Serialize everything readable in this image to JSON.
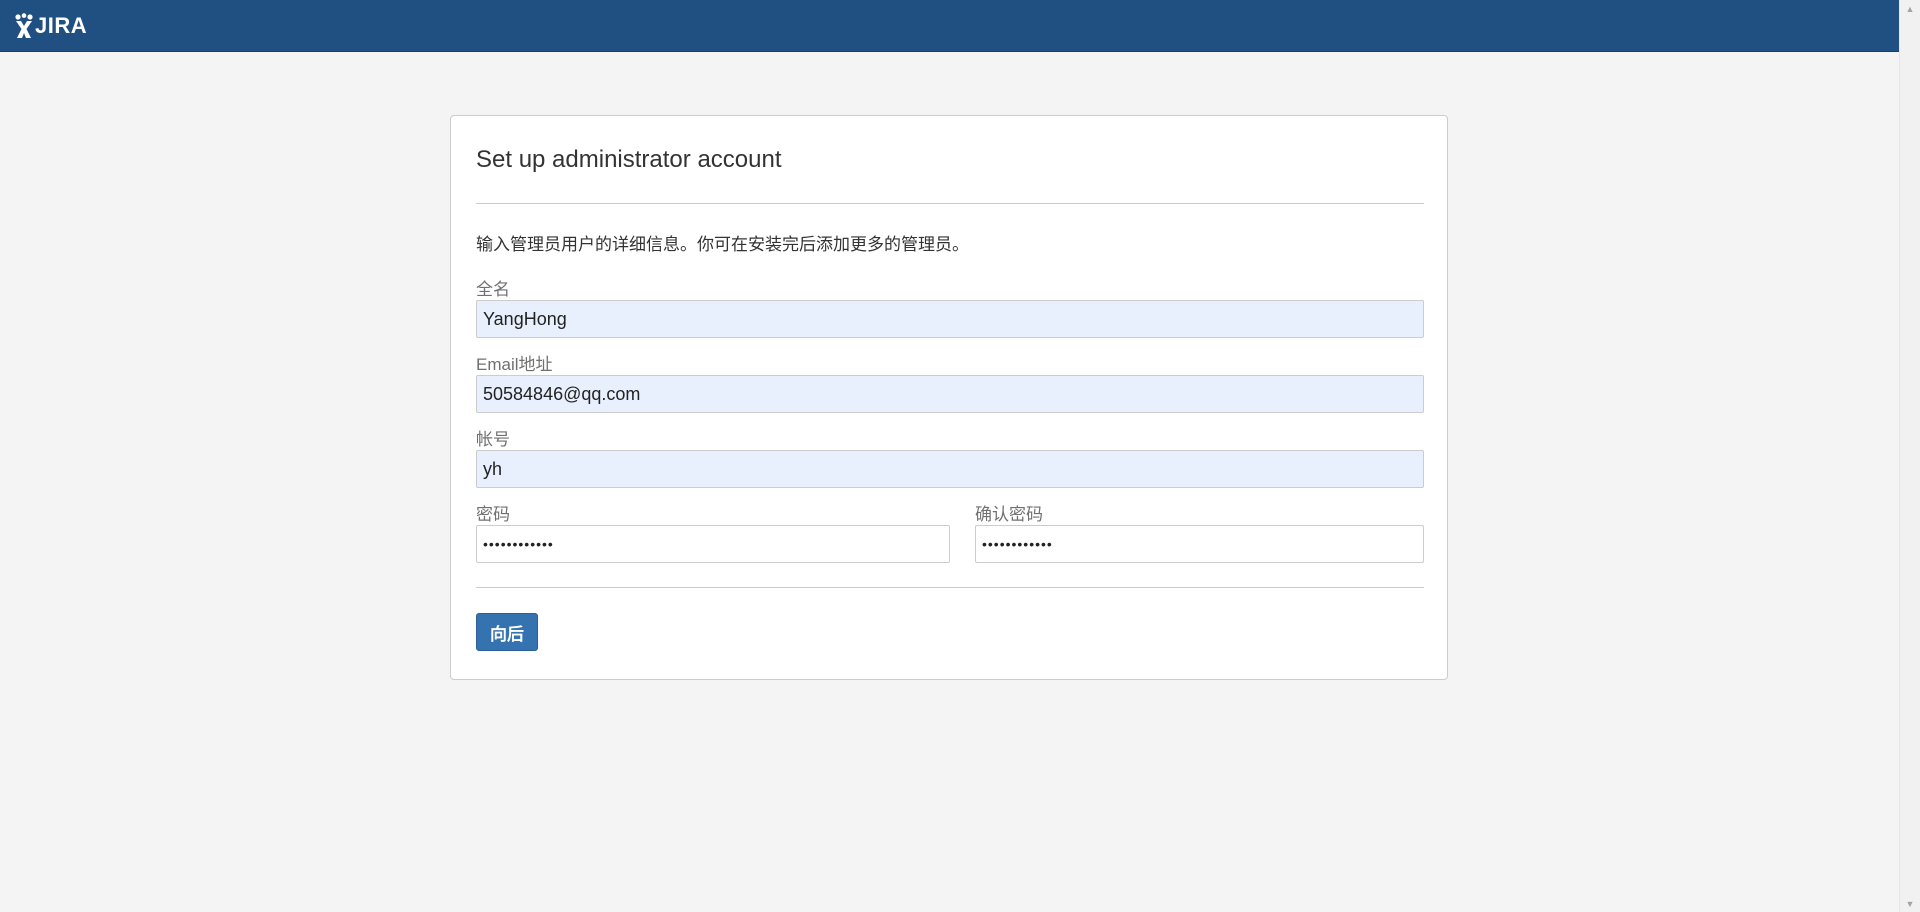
{
  "header": {
    "logo_text": "JIRA"
  },
  "panel": {
    "title": "Set up administrator account",
    "description": "输入管理员用户的详细信息。你可在安装完后添加更多的管理员。"
  },
  "fields": {
    "fullname": {
      "label": "全名",
      "value": "YangHong"
    },
    "email": {
      "label": "Email地址",
      "value": "50584846@qq.com"
    },
    "username": {
      "label": "帐号",
      "value": "yh"
    },
    "password": {
      "label": "密码",
      "value": "••••••••••••"
    },
    "confirm_password": {
      "label": "确认密码",
      "value": "••••••••••••"
    }
  },
  "actions": {
    "next_label": "向后"
  },
  "colors": {
    "header_bg": "#205081",
    "button_bg": "#3572b0",
    "autofill_bg": "#e8f0fe",
    "page_bg": "#f4f4f4"
  },
  "icons": {
    "logo": "jira-logo-icon",
    "scroll_up": "scroll-up-arrow-icon",
    "scroll_down": "scroll-down-arrow-icon"
  }
}
